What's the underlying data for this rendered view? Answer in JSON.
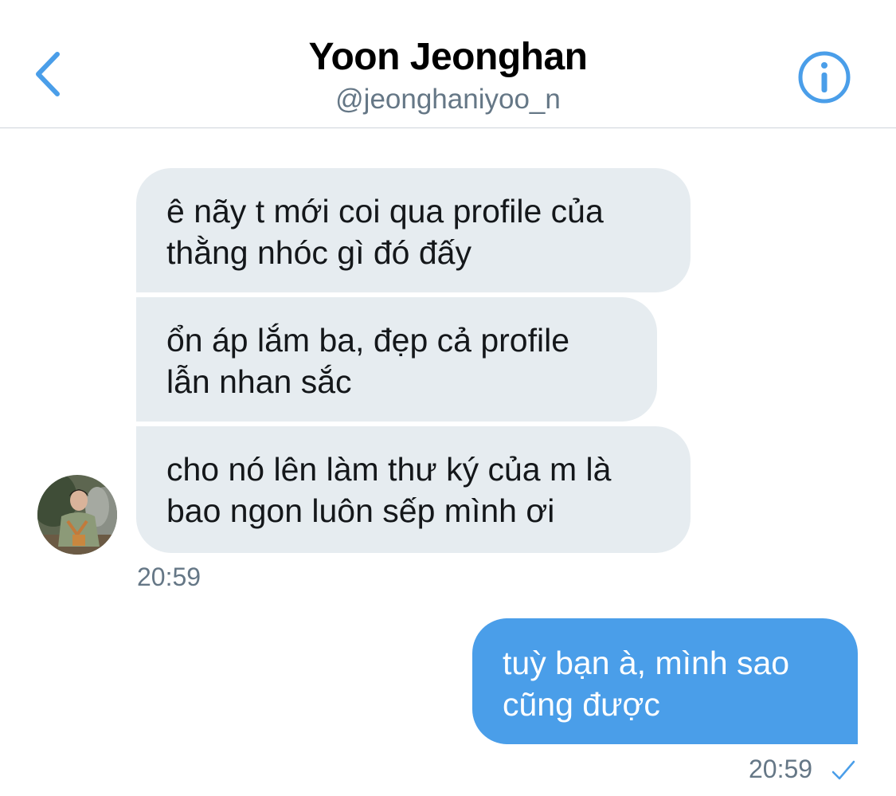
{
  "header": {
    "title": "Yoon Jeonghan",
    "handle": "@jeonghaniyoo_n",
    "back_icon": "chevron-left-icon",
    "info_icon": "info-circle-icon"
  },
  "colors": {
    "accent": "#4a9ee9",
    "incoming_bubble": "#e6ecf0",
    "meta_text": "#657786"
  },
  "messages": {
    "incoming": [
      {
        "text": "ê nãy t mới coi qua profile của\nthằng nhóc gì đó đấy"
      },
      {
        "text": "ổn áp lắm ba, đẹp cả profile\nlẫn nhan sắc"
      },
      {
        "text": "cho nó lên làm thư ký của m là\nbao ngon luôn sếp mình ơi"
      }
    ],
    "incoming_time": "20:59",
    "outgoing": [
      {
        "text": "tuỳ bạn à, mình sao\ncũng được"
      }
    ],
    "outgoing_time": "20:59",
    "outgoing_status_icon": "checkmark-icon"
  }
}
